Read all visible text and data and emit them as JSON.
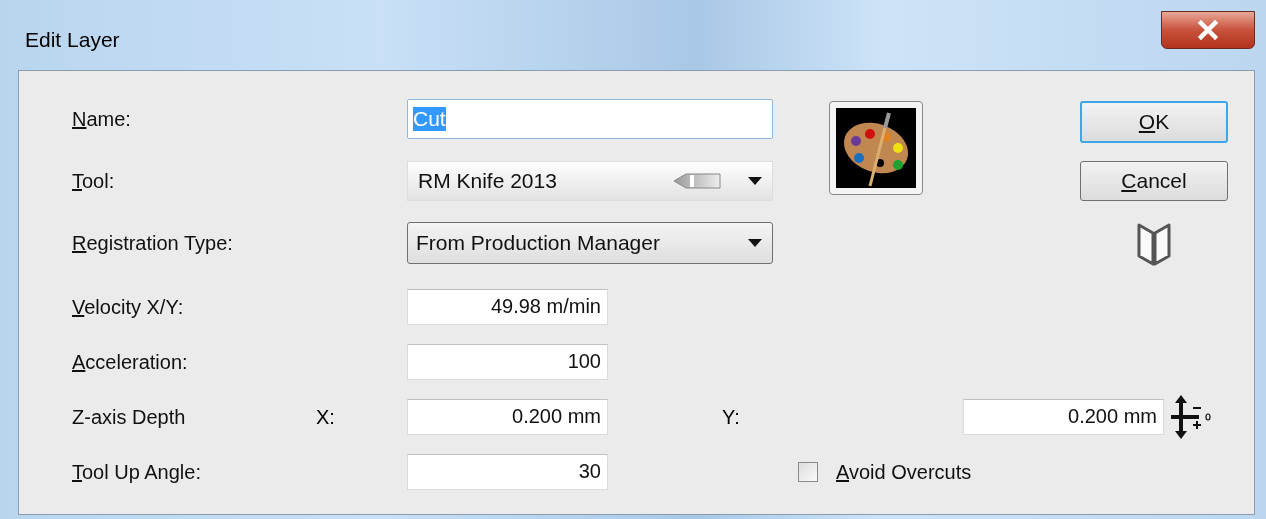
{
  "window": {
    "title": "Edit Layer"
  },
  "name": {
    "label": "Name:",
    "mnemonic": true,
    "value": "Cut",
    "text_selected": true
  },
  "tool": {
    "label": "Tool:",
    "mnemonic": true,
    "value": "RM Knife 2013"
  },
  "registration_type": {
    "label": "Registration Type:",
    "mnemonic": true,
    "value": "From Production Manager"
  },
  "velocity": {
    "label": "Velocity X/Y:",
    "mnemonic": true,
    "value": "49.98 m/min"
  },
  "acceleration": {
    "label": "Acceleration:",
    "mnemonic": true,
    "value": "100"
  },
  "z_axis_depth": {
    "label": "Z-axis Depth",
    "mnemonic": false,
    "x_label": "X:",
    "x_value": "0.200 mm",
    "y_label": "Y:",
    "y_value": "0.200 mm"
  },
  "tool_up_angle": {
    "label": "Tool Up Angle:",
    "mnemonic": true,
    "value": "30"
  },
  "avoid_overcuts": {
    "label": "Avoid Overcuts",
    "mnemonic": true,
    "checked": false
  },
  "buttons": [
    {
      "label": "OK",
      "mnemonic": true,
      "default": true
    },
    {
      "label": "Cancel",
      "mnemonic": true,
      "default": false
    }
  ]
}
